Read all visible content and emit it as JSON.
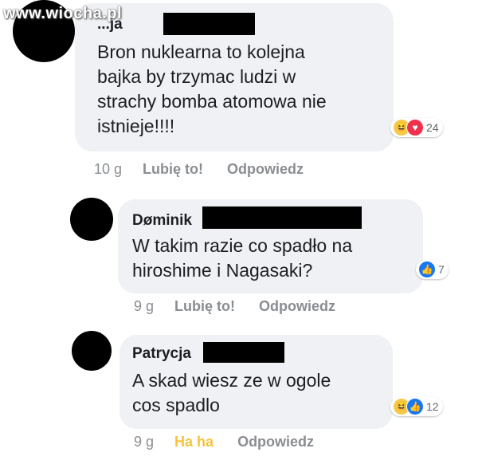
{
  "watermark": "www.wiocha.pl",
  "colors": {
    "haha": "#f5c33b",
    "like": "#1877f2",
    "love": "#f0314d",
    "meta": "#8a8d91",
    "bubble": "#f0f1f4"
  },
  "comments": [
    {
      "author": "...ja",
      "text": "Bron nuklearna to kolejna\nbajka by trzymac ludzi w\nstrachy bomba atomowa nie\nistnieje!!!!",
      "reactions": {
        "icons": [
          "haha-icon",
          "love-icon"
        ],
        "count": "24"
      },
      "time": "10 g",
      "like_label": "Lubię to!",
      "reply_label": "Odpowiedz"
    },
    {
      "author": "Døminik",
      "text": "W takim razie co spadło na\nhiroshime i Nagasaki?",
      "reactions": {
        "icons": [
          "like-icon"
        ],
        "count": "7"
      },
      "time": "9 g",
      "like_label": "Lubię to!",
      "reply_label": "Odpowiedz"
    },
    {
      "author": "Patrycja",
      "text": "A skad wiesz ze w ogole\ncos spadlo",
      "reactions": {
        "icons": [
          "haha-icon",
          "like-icon"
        ],
        "count": "12"
      },
      "time": "9 g",
      "like_label": "Ha ha",
      "reply_label": "Odpowiedz"
    }
  ]
}
